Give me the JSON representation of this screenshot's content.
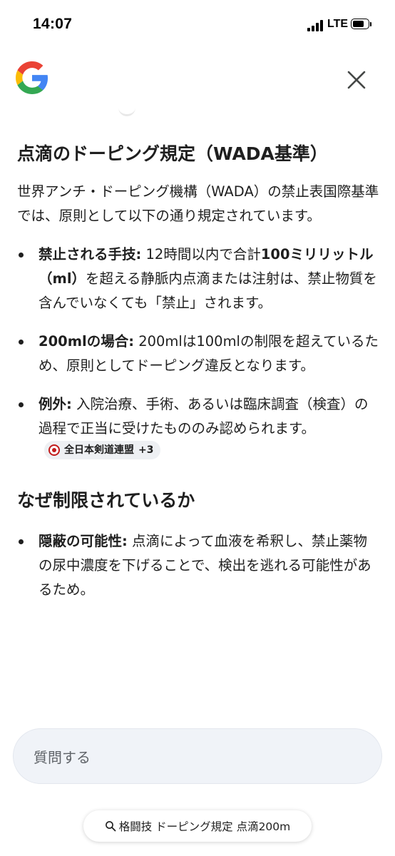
{
  "status_bar": {
    "time": "14:07",
    "network": "LTE"
  },
  "header": {
    "logo_icon": "google-g-icon",
    "close_icon": "close-icon"
  },
  "article": {
    "heading1": "点滴のドーピング規定（WADA基準）",
    "intro": "世界アンチ・ドーピング機構（WADA）の禁止表国際基準では、原則として以下の通り規定されています。",
    "bullets1": [
      {
        "label": "禁止される手技:",
        "text_pre": " 12時間以内で合計",
        "text_bold": "100ミリリットル（ml）",
        "text_post": "を超える静脈内点滴または注射は、禁止物質を含んでいなくても「禁止」されます。"
      },
      {
        "label": "200mlの場合:",
        "text": " 200mlは100mlの制限を超えているため、原則としてドーピング違反となります。"
      },
      {
        "label": "例外:",
        "text": " 入院治療、手術、あるいは臨床調査（検査）の過程で正当に受けたもののみ認められます。",
        "source_name": "全日本剣道連盟",
        "source_count": "+3"
      }
    ],
    "heading2": "なぜ制限されているか",
    "bullets2": [
      {
        "label": "隠蔽の可能性:",
        "text": " 点滴によって血液を希釈し、禁止薬物の尿中濃度を下げることで、検出を逃れる可能性があるため。"
      }
    ]
  },
  "ask": {
    "placeholder": "質問する"
  },
  "query_chip": {
    "icon": "search-icon",
    "text": "格闘技 ドーピング規定 点滴200m"
  }
}
